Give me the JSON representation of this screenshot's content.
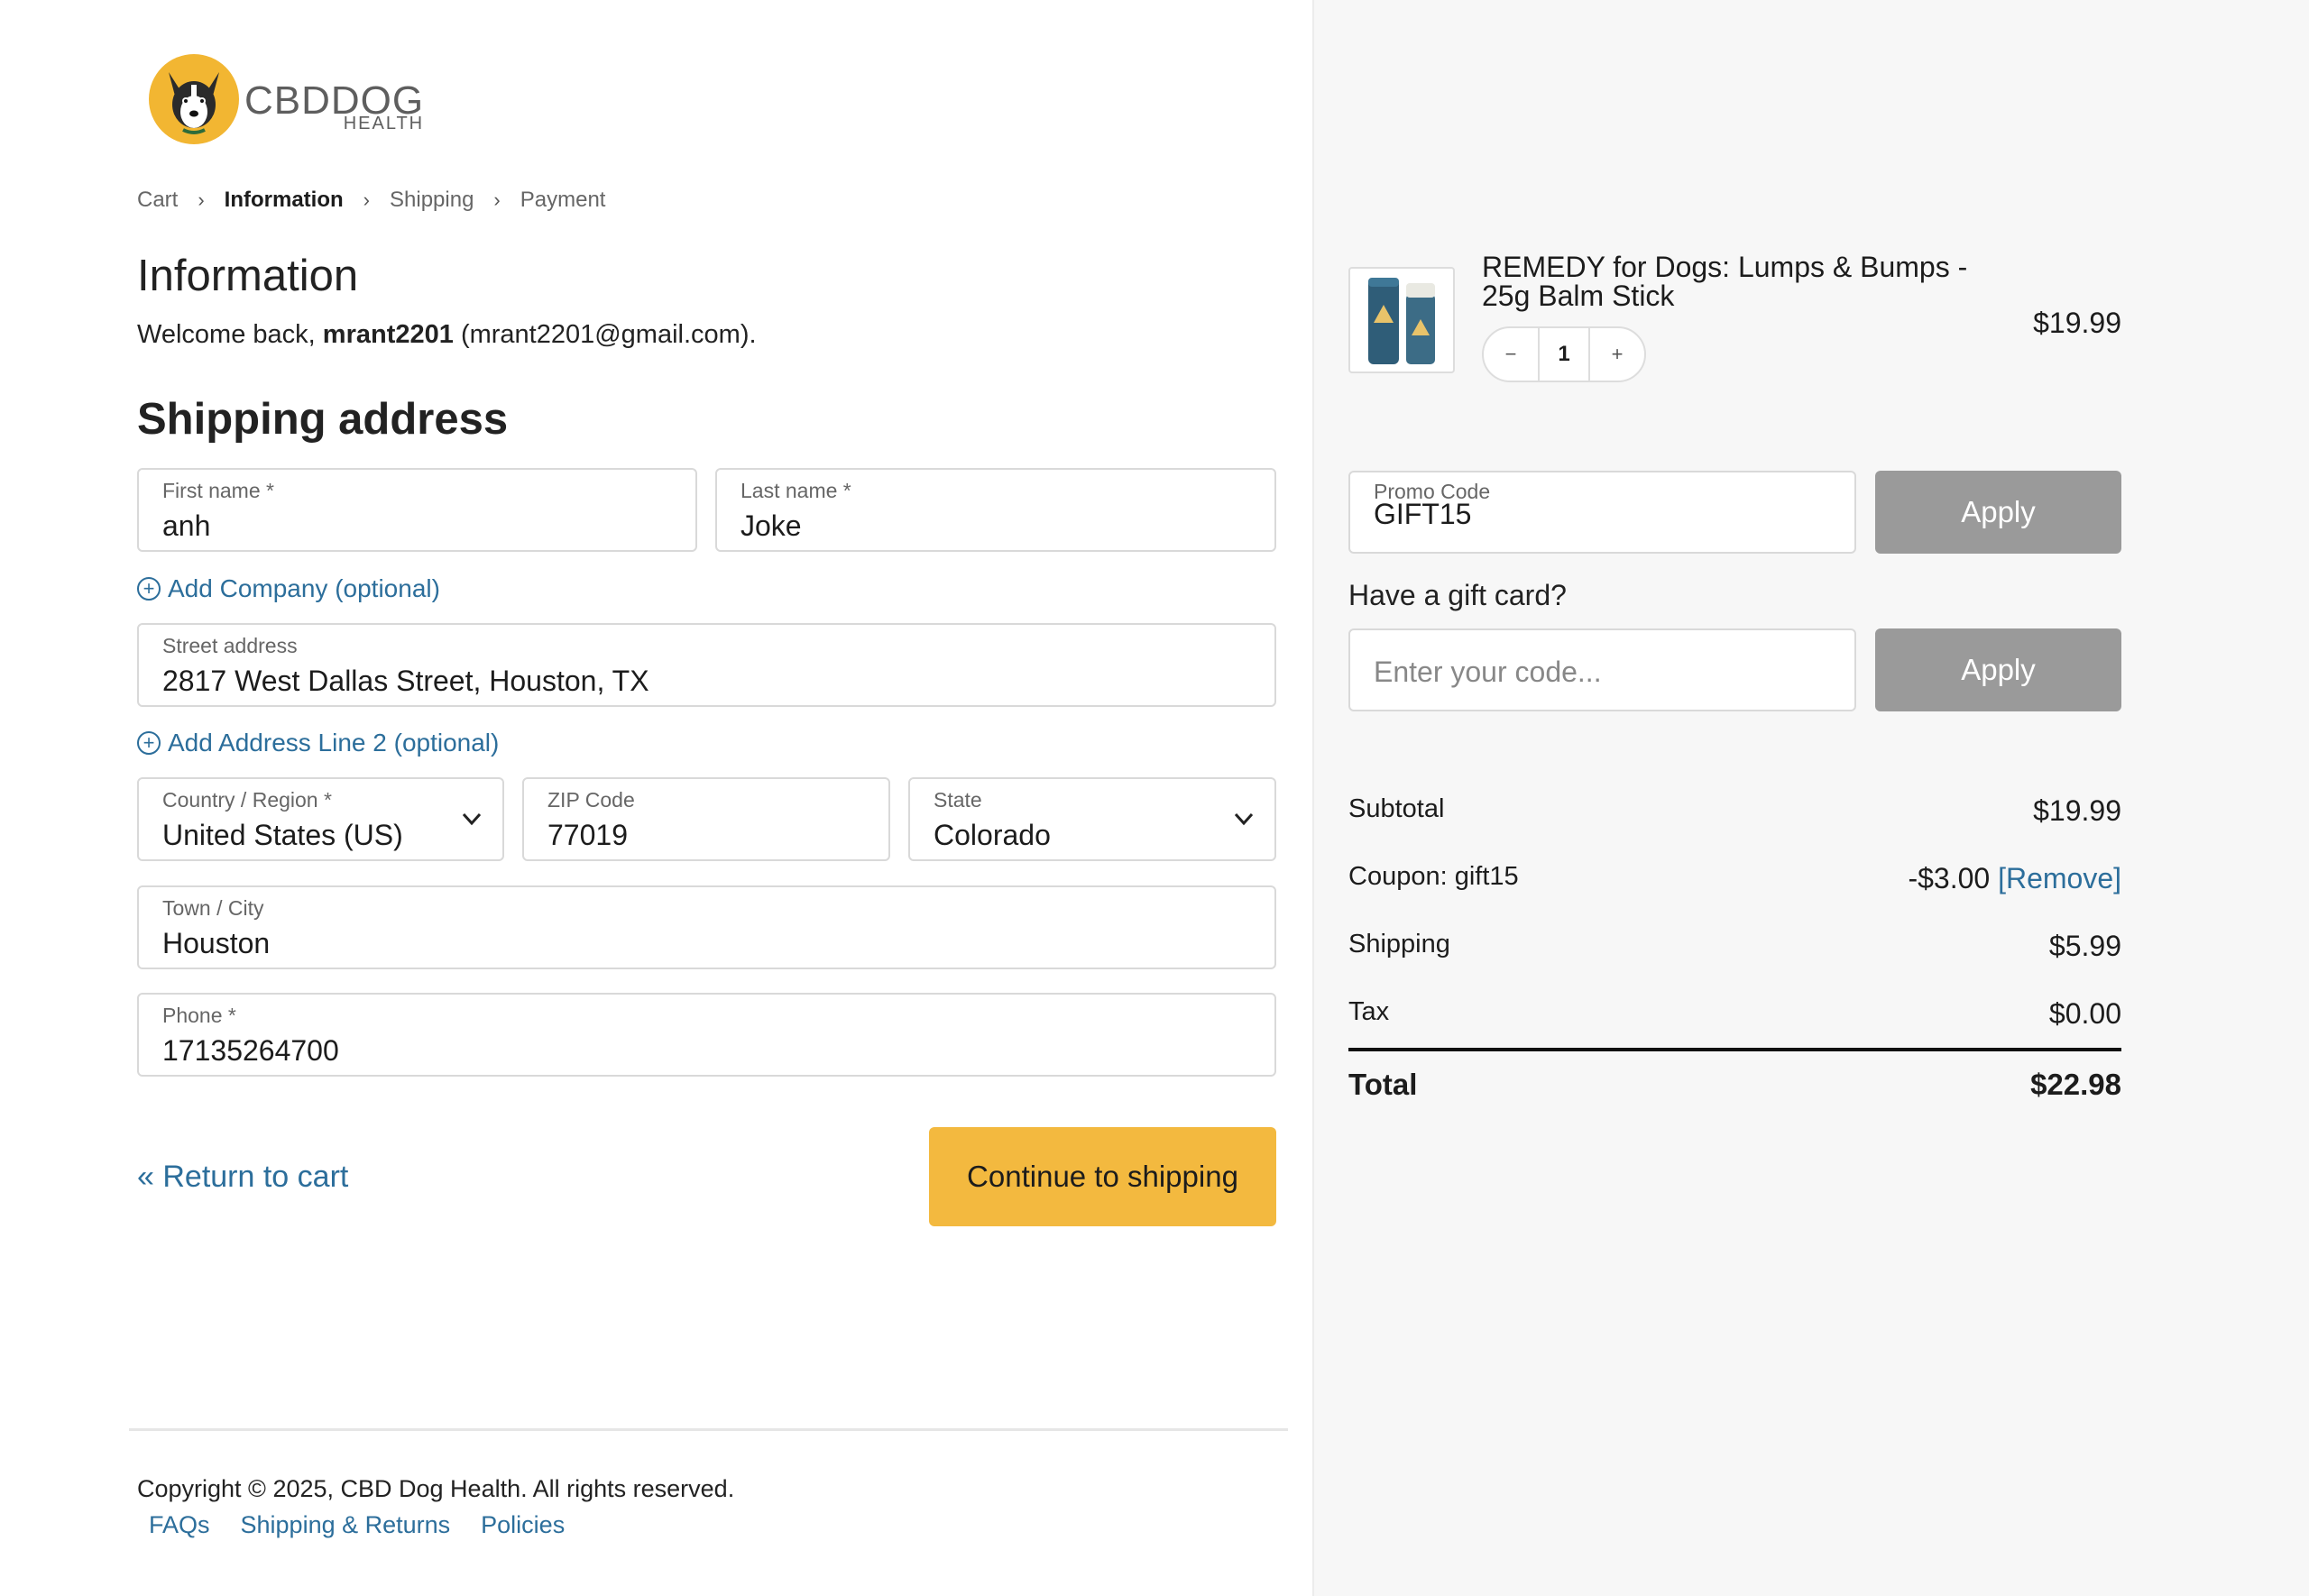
{
  "brand": {
    "name": "CBDDOG",
    "sub": "HEALTH"
  },
  "breadcrumb": [
    "Cart",
    "Information",
    "Shipping",
    "Payment"
  ],
  "information": {
    "heading": "Information",
    "welcome_prefix": "Welcome back,",
    "username": "mrant2201",
    "email_part": "(mrant2201@gmail.com)."
  },
  "shipping": {
    "heading": "Shipping address",
    "first_name": {
      "label": "First name *",
      "value": "anh"
    },
    "last_name": {
      "label": "Last name *",
      "value": "Joke"
    },
    "add_company": "Add Company (optional)",
    "street": {
      "label": "Street address",
      "value": "2817 West Dallas Street, Houston, TX"
    },
    "add_line2": "Add Address Line 2 (optional)",
    "country": {
      "label": "Country / Region *",
      "value": "United States (US)"
    },
    "zip": {
      "label": "ZIP Code",
      "value": "77019"
    },
    "state": {
      "label": "State",
      "value": "Colorado"
    },
    "city": {
      "label": "Town / City",
      "value": "Houston"
    },
    "phone": {
      "label": "Phone *",
      "value": "17135264700"
    }
  },
  "actions": {
    "return_label": "« Return to cart",
    "continue_label": "Continue to shipping"
  },
  "footer": {
    "copyright": "Copyright © 2025, CBD Dog Health. All rights reserved.",
    "links": [
      "FAQs",
      "Shipping & Returns",
      "Policies"
    ]
  },
  "order": {
    "product_name": "REMEDY for Dogs: Lumps & Bumps - 25g Balm Stick",
    "price": "$19.99",
    "quantity": "1",
    "qty_minus": "−",
    "qty_plus": "+"
  },
  "promo": {
    "label": "Promo Code",
    "value": "GIFT15",
    "apply": "Apply"
  },
  "gift": {
    "question": "Have a gift card?",
    "placeholder": "Enter your code...",
    "apply": "Apply"
  },
  "summary": {
    "subtotal_label": "Subtotal",
    "subtotal": "$19.99",
    "coupon_label": "Coupon: gift15",
    "coupon": "-$3.00",
    "remove": "[Remove]",
    "shipping_label": "Shipping",
    "shipping": "$5.99",
    "tax_label": "Tax",
    "tax": "$0.00",
    "total_label": "Total",
    "total": "$22.98"
  },
  "colors": {
    "accent_link": "#2c6e9b",
    "cta": "#f3b93f",
    "apply_disabled": "#9a9a9a",
    "logo_badge": "#f2b632"
  }
}
